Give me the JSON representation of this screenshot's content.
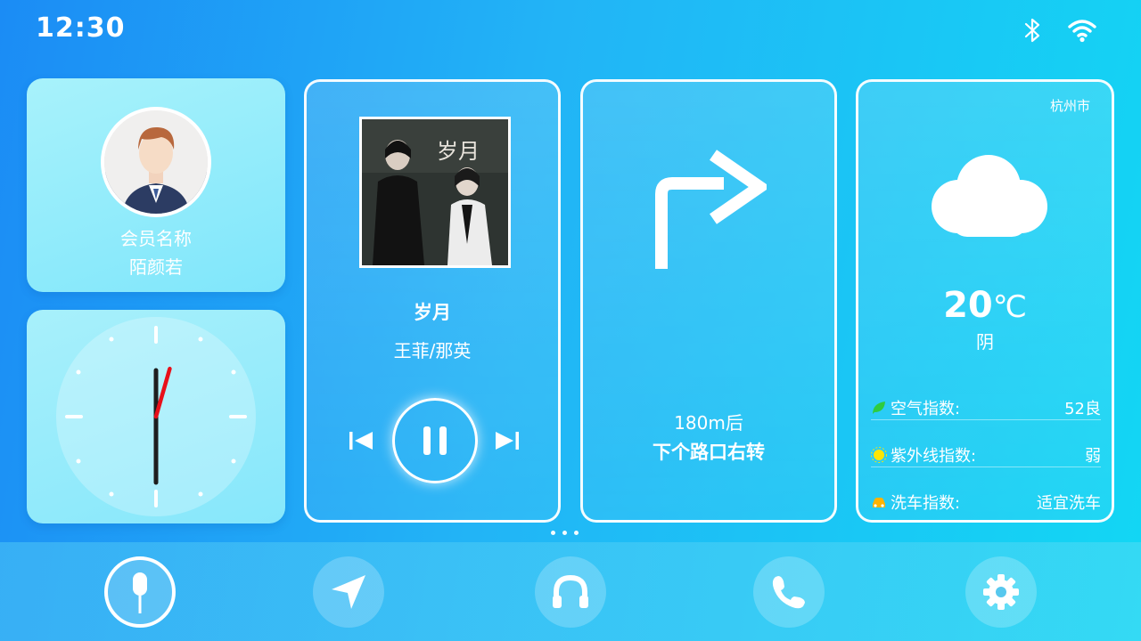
{
  "status_bar": {
    "time": "12:30",
    "icons": [
      "bluetooth-icon",
      "wifi-icon"
    ]
  },
  "member": {
    "label": "会员名称",
    "name": "陌颜若"
  },
  "analog_clock": {
    "hour": 12,
    "minute": 30,
    "second": 2
  },
  "music": {
    "album_title_art": "岁月",
    "title": "岁月",
    "artist": "王菲/那英",
    "state": "playing",
    "controls": [
      "previous-icon",
      "pause-icon",
      "next-icon"
    ]
  },
  "navigation": {
    "distance": "180m后",
    "instruction": "下个路口右转",
    "direction_icon": "turn-right-arrow-icon"
  },
  "weather": {
    "city": "杭州市",
    "temperature": "20",
    "unit": "℃",
    "condition": "阴",
    "condition_icon": "cloud-icon",
    "indices": [
      {
        "label": "空气指数:",
        "value": "52良",
        "icon": "leaf-icon",
        "color": "#2ecc40"
      },
      {
        "label": "紫外线指数:",
        "value": "弱",
        "icon": "sun-icon",
        "color": "#ffe600"
      },
      {
        "label": "洗车指数:",
        "value": "适宜洗车",
        "icon": "car-icon",
        "color": "#ffb300"
      }
    ]
  },
  "pager": {
    "pages": 3
  },
  "dock": {
    "items": [
      "microphone-icon",
      "navigation-icon",
      "headphones-icon",
      "phone-icon",
      "settings-icon"
    ],
    "active": "microphone-icon"
  },
  "colors": {
    "background_start": "#1b8cf5",
    "background_end": "#12d7f4",
    "clock_second_hand": "#e8101a"
  }
}
